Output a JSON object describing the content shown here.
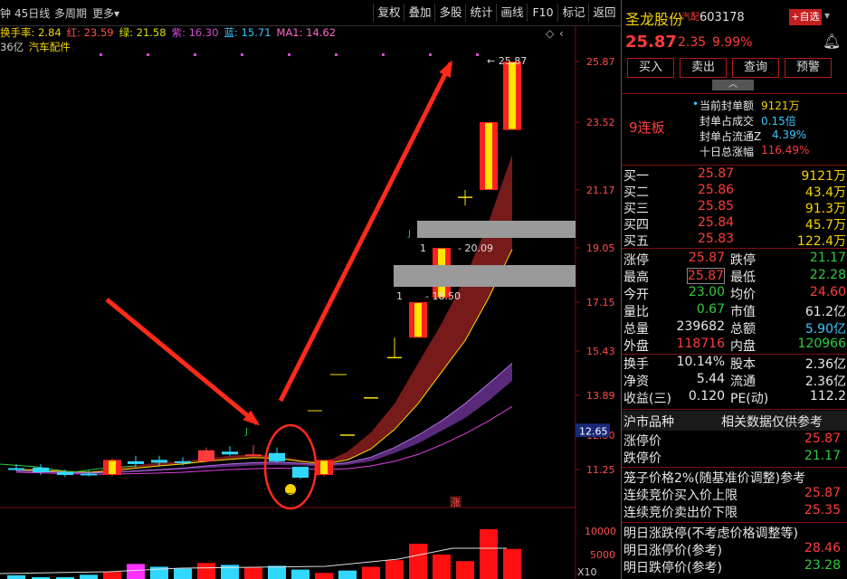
{
  "toolbar": {
    "period_prefix": "钟",
    "period": "45日线",
    "multi_period": "多周期",
    "more": "更多",
    "more_arrow": "▾",
    "buttons": [
      "复权",
      "叠加",
      "多股",
      "统计",
      "画线",
      "F10",
      "标记",
      "返回"
    ]
  },
  "indicators": {
    "line1": [
      {
        "label": "换手率: ",
        "value": "2.84",
        "color": "#f5d300"
      },
      {
        "label": "红: ",
        "value": "23.59",
        "color": "#ff4d4d"
      },
      {
        "label": "绿: ",
        "value": "21.58",
        "color": "#d8e000"
      },
      {
        "label": "紫: ",
        "value": "16.30",
        "color": "#d04cd0"
      },
      {
        "label": "蓝: ",
        "value": "15.71",
        "color": "#3cc7ff"
      },
      {
        "label": "MA1: ",
        "value": "14.62",
        "color": "#ff66cc"
      }
    ],
    "line2_value": "36亿",
    "line2_sector": "汽车配件"
  },
  "chart_data": {
    "type": "candlestick",
    "y_ticks": [
      "25.87",
      "23.52",
      "21.17",
      "19.05",
      "17.15",
      "15.43",
      "13.89",
      "12.50",
      "11.25"
    ],
    "current_price_tag": "12.65",
    "annotations": {
      "top_price": "25.87",
      "mid1": "20.09",
      "mid2": "18.50",
      "mid1_prefix": "1",
      "mid2_prefix": "1",
      "j_marks": [
        "J",
        "J"
      ],
      "limit_icon": "涨"
    },
    "volume_ticks": [
      "10000",
      "5000"
    ],
    "volume_unit": "X10",
    "candles": [
      {
        "o": 11.3,
        "c": 11.3,
        "h": 11.45,
        "l": 11.2,
        "color": "cyan"
      },
      {
        "o": 11.32,
        "c": 11.15,
        "h": 11.45,
        "l": 11.05,
        "color": "cyan"
      },
      {
        "o": 11.15,
        "c": 11.05,
        "h": 11.25,
        "l": 10.98,
        "color": "cyan"
      },
      {
        "o": 11.1,
        "c": 11.1,
        "h": 11.2,
        "l": 11.0,
        "color": "cyan"
      },
      {
        "o": 11.05,
        "c": 11.6,
        "h": 11.65,
        "l": 11.0,
        "color": "limit"
      },
      {
        "o": 11.55,
        "c": 11.45,
        "h": 11.75,
        "l": 11.35,
        "color": "cyan"
      },
      {
        "o": 11.5,
        "c": 11.6,
        "h": 11.75,
        "l": 11.4,
        "color": "cyan"
      },
      {
        "o": 11.55,
        "c": 11.5,
        "h": 11.7,
        "l": 11.4,
        "color": "cyan"
      },
      {
        "o": 11.55,
        "c": 11.95,
        "h": 12.05,
        "l": 11.5,
        "color": "red"
      },
      {
        "o": 11.9,
        "c": 11.8,
        "h": 12.1,
        "l": 11.75,
        "color": "cyan"
      },
      {
        "o": 11.8,
        "c": 11.8,
        "h": 12.15,
        "l": 11.75,
        "color": "red"
      },
      {
        "o": 11.85,
        "c": 11.55,
        "h": 12.05,
        "l": 11.5,
        "color": "cyan"
      },
      {
        "o": 11.35,
        "c": 10.95,
        "h": 11.35,
        "l": 10.9,
        "color": "cyan"
      },
      {
        "o": 11.05,
        "c": 11.6,
        "h": 11.6,
        "l": 11.0,
        "color": "limit"
      },
      {
        "o": 12.5,
        "c": 12.5,
        "h": 12.5,
        "l": 12.5,
        "color": "flat"
      },
      {
        "o": 13.8,
        "c": 13.8,
        "h": 13.8,
        "l": 13.8,
        "color": "flat"
      },
      {
        "o": 15.2,
        "c": 15.2,
        "h": 15.9,
        "l": 15.2,
        "color": "flat"
      },
      {
        "o": 15.9,
        "c": 17.15,
        "h": 17.15,
        "l": 15.9,
        "color": "limit"
      },
      {
        "o": 17.3,
        "c": 19.05,
        "h": 19.05,
        "l": 17.3,
        "color": "limit"
      },
      {
        "o": 20.9,
        "c": 20.9,
        "h": 21.17,
        "l": 20.6,
        "color": "flat"
      },
      {
        "o": 21.17,
        "c": 23.52,
        "h": 23.52,
        "l": 21.17,
        "color": "limit"
      },
      {
        "o": 23.25,
        "c": 25.87,
        "h": 25.87,
        "l": 23.25,
        "color": "limit"
      }
    ]
  },
  "panel": {
    "stock_name": "圣龙股份",
    "stock_tag": "汽配",
    "stock_code": "603178",
    "add_fav": "+自选",
    "price": "25.87",
    "change": "2.35",
    "change_pct": "9.99%",
    "buttons": [
      "买入",
      "卖出",
      "查询",
      "预警"
    ],
    "streak": "9连板",
    "seal_info": [
      {
        "label": "当前封单额",
        "value": "9121万",
        "icon": "•"
      },
      {
        "label": "封单占成交",
        "value": "0.15倍"
      },
      {
        "label": "封单占流通Z",
        "value": "4.39%"
      },
      {
        "label": "十日总涨幅",
        "value": "116.49%"
      }
    ],
    "bids": [
      {
        "label": "买一",
        "price": "25.87",
        "vol": "9121万"
      },
      {
        "label": "买二",
        "price": "25.86",
        "vol": "43.4万"
      },
      {
        "label": "买三",
        "price": "25.85",
        "vol": "91.3万"
      },
      {
        "label": "买四",
        "price": "25.84",
        "vol": "45.7万"
      },
      {
        "label": "买五",
        "price": "25.83",
        "vol": "122.4万"
      }
    ],
    "stats": [
      {
        "l1": "涨停",
        "v1": "25.87",
        "c1": "red",
        "l2": "跌停",
        "v2": "21.17",
        "c2": "green"
      },
      {
        "l1": "最高",
        "v1": "25.87",
        "c1": "red",
        "l2": "最低",
        "v2": "22.28",
        "c2": "green"
      },
      {
        "l1": "今开",
        "v1": "23.00",
        "c1": "green",
        "l2": "均价",
        "v2": "24.60",
        "c2": "red"
      },
      {
        "l1": "量比",
        "v1": "0.67",
        "c1": "green",
        "l2": "市值",
        "v2": "61.2亿",
        "c2": "white"
      },
      {
        "l1": "总量",
        "v1": "239682",
        "c1": "white",
        "l2": "总额",
        "v2": "5.90亿",
        "c2": "cyan"
      },
      {
        "l1": "外盘",
        "v1": "118716",
        "c1": "red",
        "l2": "内盘",
        "v2": "120966",
        "c2": "green"
      }
    ],
    "fundamentals": [
      {
        "l1": "换手",
        "v1": "10.14%",
        "l2": "股本",
        "v2": "2.36亿"
      },
      {
        "l1": "净资",
        "v1": "5.44",
        "l2": "流通",
        "v2": "2.36亿"
      },
      {
        "l1": "收益(三)",
        "v1": "0.120",
        "l2": "PE(动)",
        "v2": "112.2"
      }
    ],
    "market_section": {
      "title": "沪市品种",
      "note": "相关数据仅供参考"
    },
    "limits": [
      {
        "label": "涨停价",
        "value": "25.87",
        "color": "red"
      },
      {
        "label": "跌停价",
        "value": "21.17",
        "color": "green"
      }
    ],
    "cage_title": "笼子价格2%(随基准价调整)参考",
    "cage": [
      {
        "label": "连续竞价买入价上限",
        "value": "25.87"
      },
      {
        "label": "连续竞价卖出价下限",
        "value": "25.35"
      }
    ],
    "tomorrow_title": "明日涨跌停(不考虑价格调整等)",
    "tomorrow": [
      {
        "label": "明日涨停价(参考)",
        "value": "28.46",
        "color": "red"
      },
      {
        "label": "明日跌停价(参考)",
        "value": "23.28",
        "color": "green"
      }
    ]
  }
}
